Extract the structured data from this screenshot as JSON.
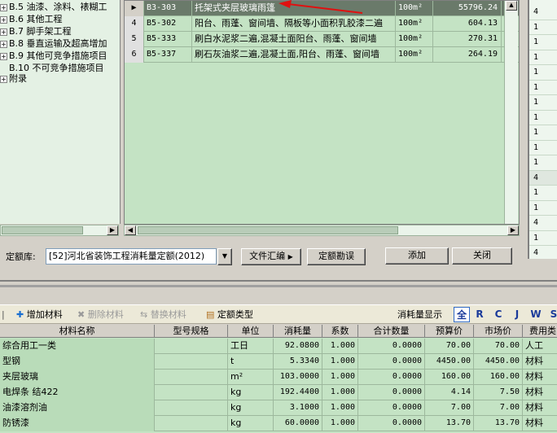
{
  "tree": {
    "items": [
      {
        "label": "B.5 油漆、涂料、裱糊工",
        "expandable": true
      },
      {
        "label": "B.6 其他工程",
        "expandable": true
      },
      {
        "label": "B.7 脚手架工程",
        "expandable": true
      },
      {
        "label": "B.8 垂直运输及超高增加",
        "expandable": true
      },
      {
        "label": "B.9 其他可竞争措施项目",
        "expandable": true
      },
      {
        "label": "B.10 不可竞争措施项目",
        "expandable": false
      },
      {
        "label": "附录",
        "expandable": true
      }
    ]
  },
  "quota_rows": [
    {
      "index": "",
      "code": "B3-303",
      "name": "托架式夹层玻璃雨篷",
      "unit": "100m²",
      "price": "55796.24",
      "selected": true
    },
    {
      "index": "4",
      "code": "B5-302",
      "name": "阳台、雨蓬、窗间墙、隔板等小面积乳胶漆二遍",
      "unit": "100m²",
      "price": "604.13"
    },
    {
      "index": "5",
      "code": "B5-333",
      "name": "刷白水泥浆二遍,混凝土面阳台、雨蓬、窗间墙",
      "unit": "100m²",
      "price": "270.31"
    },
    {
      "index": "6",
      "code": "B5-337",
      "name": "刷石灰油浆二遍,混凝土面,阳台、雨蓬、窗间墙",
      "unit": "100m²",
      "price": "264.19"
    }
  ],
  "right_column": [
    "4",
    "1",
    "1",
    "1",
    "1",
    "1",
    "1",
    "1",
    "1",
    "1",
    "1",
    "4",
    "1",
    "1",
    "4",
    "1",
    "4"
  ],
  "quota_lib": {
    "label": "定额库:",
    "value": "[52]河北省装饰工程消耗量定额(2012)"
  },
  "buttons": {
    "file_summary": "文件汇编",
    "quota_errata": "定额勘误",
    "add": "添加",
    "close": "关闭"
  },
  "toolbar": {
    "add_material": "增加材料",
    "delete_material": "删除材料",
    "replace_material": "替换材料",
    "quota_type": "定额类型",
    "consumption_display": "消耗量显示",
    "letters": [
      "全",
      "R",
      "C",
      "J",
      "W",
      "S"
    ]
  },
  "material_table": {
    "headers": [
      "材料名称",
      "型号规格",
      "单位",
      "消耗量",
      "系数",
      "合计数量",
      "预算价",
      "市场价",
      "费用类"
    ],
    "rows": [
      [
        "综合用工一类",
        "",
        "工日",
        "92.0800",
        "1.000",
        "0.0000",
        "70.00",
        "70.00",
        "人工"
      ],
      [
        "型钢",
        "",
        "t",
        "5.3340",
        "1.000",
        "0.0000",
        "4450.00",
        "4450.00",
        "材料"
      ],
      [
        "夹层玻璃",
        "",
        "m²",
        "103.0000",
        "1.000",
        "0.0000",
        "160.00",
        "160.00",
        "材料"
      ],
      [
        "电焊条 结422",
        "",
        "kg",
        "192.4400",
        "1.000",
        "0.0000",
        "4.14",
        "7.50",
        "材料"
      ],
      [
        "油漆溶剂油",
        "",
        "kg",
        "3.1000",
        "1.000",
        "0.0000",
        "7.00",
        "7.00",
        "材料"
      ],
      [
        "防锈漆",
        "",
        "kg",
        "60.0000",
        "1.000",
        "0.0000",
        "13.70",
        "13.70",
        "材料"
      ]
    ]
  },
  "colors": {
    "grid_bg": "#c4e3c4",
    "selected_row": "#6a7a6a",
    "arrow": "#e01010",
    "letter_blue": "#1a3a9a"
  }
}
